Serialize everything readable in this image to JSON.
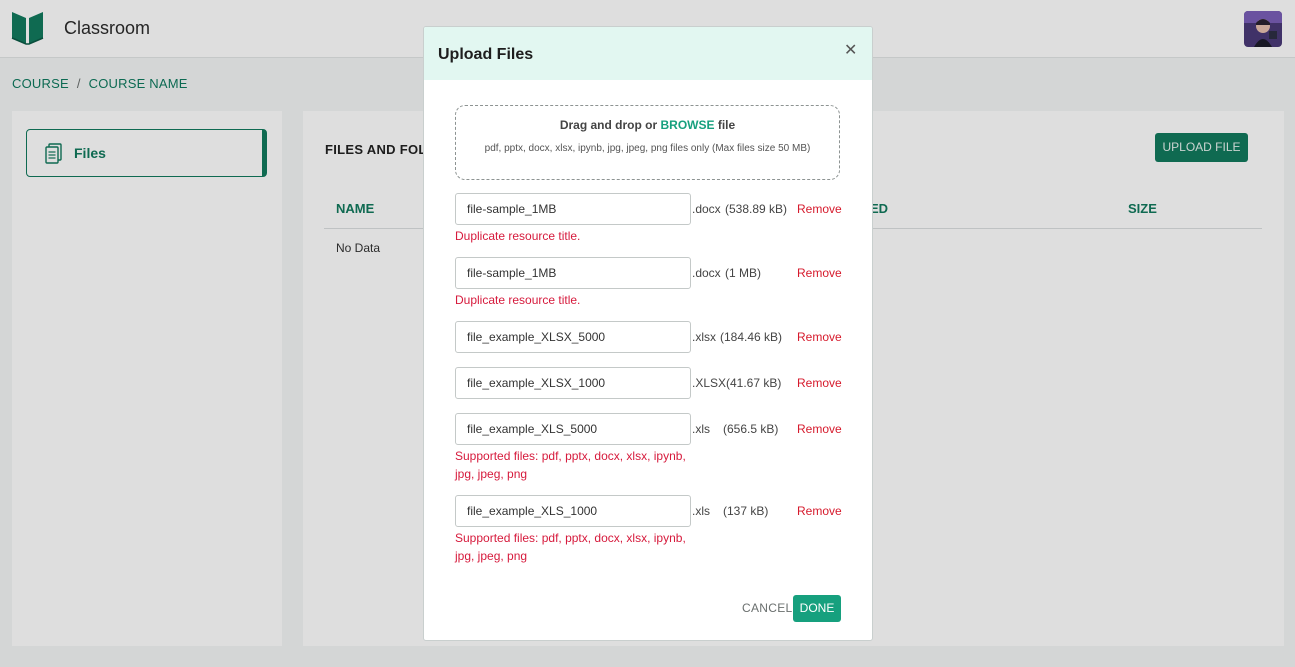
{
  "header": {
    "app_title": "Classroom",
    "logo_icon": "book-icon",
    "avatar_icon": "user-avatar"
  },
  "breadcrumb": {
    "items": [
      "COURSE",
      "COURSE NAME"
    ],
    "separator": "/"
  },
  "sidebar": {
    "items": [
      {
        "label": "Files",
        "icon": "files-icon",
        "active": true
      }
    ]
  },
  "main": {
    "title": "FILES AND FOLDERS",
    "upload_button": "UPLOAD FILE",
    "columns": [
      "NAME",
      "ED",
      "SIZE"
    ],
    "empty_text": "No Data"
  },
  "modal": {
    "title": "Upload Files",
    "close_icon": "close-icon",
    "dropzone": {
      "prefix": "Drag and drop or ",
      "browse": "BROWSE",
      "suffix": " file",
      "hint": "pdf, pptx, docx, xlsx, ipynb, jpg, jpeg, png files only (Max files size 50 MB)"
    },
    "files": [
      {
        "name": "file-sample_1MB",
        "ext": ".docx",
        "size": "(538.89 kB)",
        "remove": "Remove",
        "error": "Duplicate resource title."
      },
      {
        "name": "file-sample_1MB",
        "ext": ".docx",
        "size": "(1 MB)",
        "remove": "Remove",
        "error": "Duplicate resource title."
      },
      {
        "name": "file_example_XLSX_5000",
        "ext": ".xlsx",
        "size": "(184.46 kB)",
        "remove": "Remove",
        "error": ""
      },
      {
        "name": "file_example_XLSX_1000",
        "ext": ".XLSX",
        "size": "(41.67 kB)",
        "remove": "Remove",
        "error": ""
      },
      {
        "name": "file_example_XLS_5000",
        "ext": ".xls",
        "size": "(656.5 kB)",
        "remove": "Remove",
        "error": "Supported files: pdf, pptx, docx, xlsx, ipynb, jpg, jpeg, png"
      },
      {
        "name": "file_example_XLS_1000",
        "ext": ".xls",
        "size": "(137 kB)",
        "remove": "Remove",
        "error": "Supported files: pdf, pptx, docx, xlsx, ipynb, jpg, jpeg, png"
      }
    ],
    "cancel_label": "CANCEL",
    "done_label": "DONE"
  },
  "colors": {
    "brand": "#127a5e",
    "accent": "#16a07e",
    "error": "#d61a3c",
    "modal_header": "#e2f7f1"
  }
}
